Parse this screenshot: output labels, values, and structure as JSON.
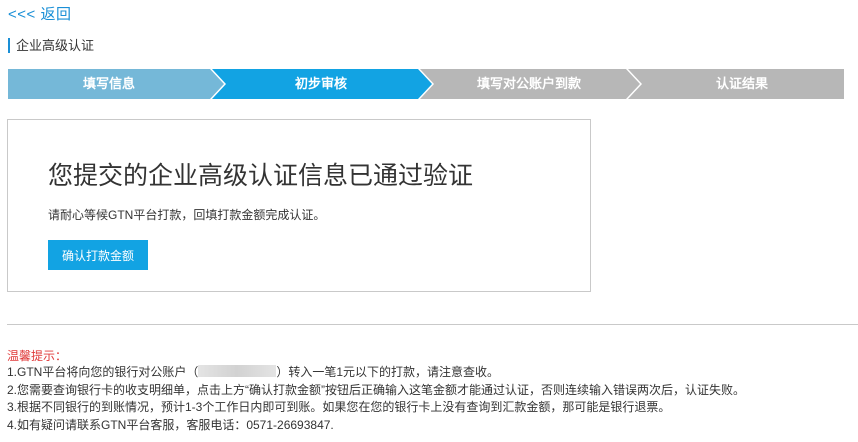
{
  "nav": {
    "back_label": "<<< 返回"
  },
  "section": {
    "title": "企业高级认证"
  },
  "steps": [
    {
      "label": "填写信息",
      "state": "done"
    },
    {
      "label": "初步审核",
      "state": "active"
    },
    {
      "label": "填写对公账户到款",
      "state": "pending"
    },
    {
      "label": "认证结果",
      "state": "pending"
    }
  ],
  "colors": {
    "accent": "#1a8fd6",
    "step_done": "#75b8d8",
    "step_active": "#12a3e3",
    "step_pending": "#b7b7b7",
    "button": "#12a3e3",
    "tips_title": "#e03a3a"
  },
  "notice": {
    "title": "您提交的企业高级认证信息已通过验证",
    "subtitle": "请耐心等候GTN平台打款，回填打款金额完成认证。",
    "button_label": "确认打款金额"
  },
  "tips": {
    "title": "温馨提示：",
    "line1_prefix": "1.GTN平台将向您的银行对公账户（",
    "line1_suffix": "）转入一笔1元以下的打款，请注意查收。",
    "line2": "2.您需要查询银行卡的收支明细单，点击上方“确认打款金额”按钮后正确输入这笔金额才能通过认证，否则连续输入错误两次后，认证失败。",
    "line3": "3.根据不同银行的到账情况，预计1-3个工作日内即可到账。如果您在您的银行卡上没有查询到汇款金额，那可能是银行退票。",
    "line4": "4.如有疑问请联系GTN平台客服，客服电话：0571-26693847."
  }
}
